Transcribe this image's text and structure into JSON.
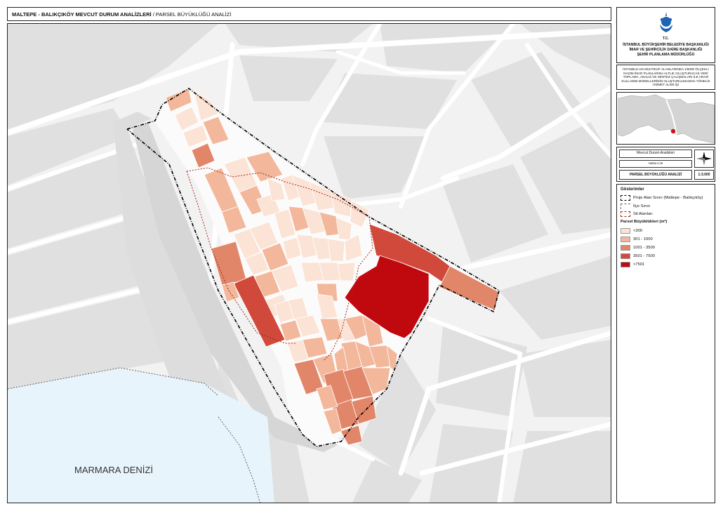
{
  "header": {
    "title_main": "MALTEPE - BALIKÇIKÖY MEVCUT DURUM ANALİZLERİ",
    "title_separator": " / ",
    "title_sub": "PARSEL BÜYÜKLÜĞÜ ANALİZİ"
  },
  "institution": {
    "tc": "T.C.",
    "line1": "İSTANBUL BÜYÜKŞEHİR BELEDİYE BAŞKANLIĞI",
    "line2": "İMAR VE ŞEHİRCİLİK DAİRE BAŞKANLIĞI",
    "line3": "ŞEHİR PLANLAMA MÜDÜRLÜĞÜ"
  },
  "project_description": "İSTANBUL'UN MUHTELİF ALANLARINDA 1/5000 ÖLÇEKLİ NAZIM İMAR PLANLARINA ALTLIK OLUŞTURACAK VERİ TOPLAMA, ANALİZ VE SENTEZ ÇALIŞMALARI İLE ARAZİ KULLANIM MODELLERİNİN OLUŞTURULMASINA YÖNELİK HİZMET ALIMI İŞİ",
  "info": {
    "analysis": "Mevcut Durum Analizleri",
    "map_no": "Harita 2.19",
    "subtitle": "PARSEL BÜYÜKLÜĞÜ ANALİZİ",
    "scale": "1:3.000"
  },
  "legend": {
    "heading": "Gösterimler",
    "boundaries": [
      {
        "label": "Proje Alan Sınırı (Maltepe - Balıkçıköy)",
        "style": "project"
      },
      {
        "label": "İlçe Sınırı",
        "style": "district"
      },
      {
        "label": "Sit Alanları",
        "style": "sit"
      }
    ],
    "classes_title": "Parsel Büyüklükleri (m²)",
    "classes": [
      {
        "label": "<300",
        "color": "#fbe3d5"
      },
      {
        "label": "301 - 1000",
        "color": "#f3b89b"
      },
      {
        "label": "1001 - 3500",
        "color": "#e2866a"
      },
      {
        "label": "3501 - 7500",
        "color": "#d1493a"
      },
      {
        "label": ">7501",
        "color": "#c0080f"
      }
    ]
  },
  "map": {
    "sea_label": "MARMARA DENİZİ",
    "colors": {
      "sea": "#e8f4fb",
      "land": "#f2f2f2",
      "block": "#e0e0e0",
      "road": "#ffffff",
      "highway": "#d8d8d8"
    }
  }
}
